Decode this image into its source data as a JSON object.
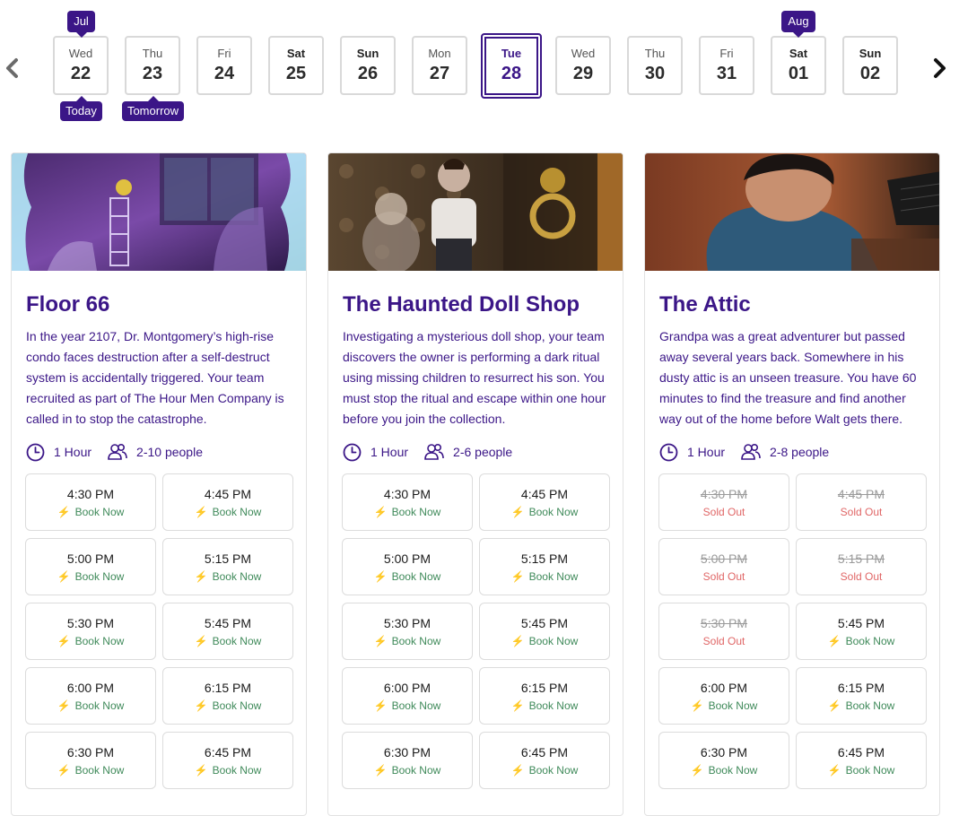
{
  "date_strip": {
    "month_labels": [
      "Jul",
      "Aug"
    ],
    "relative_labels": [
      "Today",
      "Tomorrow"
    ],
    "days": [
      {
        "dow": "Wed",
        "num": "22"
      },
      {
        "dow": "Thu",
        "num": "23"
      },
      {
        "dow": "Fri",
        "num": "24"
      },
      {
        "dow": "Sat",
        "num": "25"
      },
      {
        "dow": "Sun",
        "num": "26"
      },
      {
        "dow": "Mon",
        "num": "27"
      },
      {
        "dow": "Tue",
        "num": "28"
      },
      {
        "dow": "Wed",
        "num": "29"
      },
      {
        "dow": "Thu",
        "num": "30"
      },
      {
        "dow": "Fri",
        "num": "31"
      },
      {
        "dow": "Sat",
        "num": "01"
      },
      {
        "dow": "Sun",
        "num": "02"
      }
    ],
    "selected_day": "28",
    "prev_icon": "chevron-left-icon",
    "next_icon": "chevron-right-icon"
  },
  "colors": {
    "brand": "#3b1687",
    "book_now": "#3f8a5a",
    "sold_out": "#e06666"
  },
  "rooms": [
    {
      "title": "Floor 66",
      "image_icon": "neon-apartment-image",
      "description": "In the year 2107, Dr. Montgomery’s high-rise condo faces destruction after a self-destruct system is accidentally triggered. Your team recruited as part of The Hour Men Company is called in to stop the catastrophe.",
      "duration": "1 Hour",
      "players": "2-10 people",
      "slots": [
        {
          "time": "4:30 PM",
          "status": "Book Now"
        },
        {
          "time": "4:45 PM",
          "status": "Book Now"
        },
        {
          "time": "5:00 PM",
          "status": "Book Now"
        },
        {
          "time": "5:15 PM",
          "status": "Book Now"
        },
        {
          "time": "5:30 PM",
          "status": "Book Now"
        },
        {
          "time": "5:45 PM",
          "status": "Book Now"
        },
        {
          "time": "6:00 PM",
          "status": "Book Now"
        },
        {
          "time": "6:15 PM",
          "status": "Book Now"
        },
        {
          "time": "6:30 PM",
          "status": "Book Now"
        },
        {
          "time": "6:45 PM",
          "status": "Book Now"
        }
      ]
    },
    {
      "title": "The Haunted Doll Shop",
      "image_icon": "doll-shop-image",
      "description": "Investigating a mysterious doll shop, your team discovers the owner is performing a dark ritual using missing children to resurrect his son. You must stop the ritual and escape within one hour before you join the collection.",
      "duration": "1 Hour",
      "players": "2-6 people",
      "slots": [
        {
          "time": "4:30 PM",
          "status": "Book Now"
        },
        {
          "time": "4:45 PM",
          "status": "Book Now"
        },
        {
          "time": "5:00 PM",
          "status": "Book Now"
        },
        {
          "time": "5:15 PM",
          "status": "Book Now"
        },
        {
          "time": "5:30 PM",
          "status": "Book Now"
        },
        {
          "time": "5:45 PM",
          "status": "Book Now"
        },
        {
          "time": "6:00 PM",
          "status": "Book Now"
        },
        {
          "time": "6:15 PM",
          "status": "Book Now"
        },
        {
          "time": "6:30 PM",
          "status": "Book Now"
        },
        {
          "time": "6:45 PM",
          "status": "Book Now"
        }
      ]
    },
    {
      "title": "The Attic",
      "image_icon": "boy-at-computer-image",
      "description": "Grandpa was a great adventurer but passed away several years back. Somewhere in his dusty attic is an unseen treasure. You have 60 minutes to find the treasure and find another way out of the home before Walt gets there.",
      "duration": "1 Hour",
      "players": "2-8 people",
      "slots": [
        {
          "time": "4:30 PM",
          "status": "Sold Out"
        },
        {
          "time": "4:45 PM",
          "status": "Sold Out"
        },
        {
          "time": "5:00 PM",
          "status": "Sold Out"
        },
        {
          "time": "5:15 PM",
          "status": "Sold Out"
        },
        {
          "time": "5:30 PM",
          "status": "Sold Out"
        },
        {
          "time": "5:45 PM",
          "status": "Book Now"
        },
        {
          "time": "6:00 PM",
          "status": "Book Now"
        },
        {
          "time": "6:15 PM",
          "status": "Book Now"
        },
        {
          "time": "6:30 PM",
          "status": "Book Now"
        },
        {
          "time": "6:45 PM",
          "status": "Book Now"
        }
      ]
    }
  ]
}
